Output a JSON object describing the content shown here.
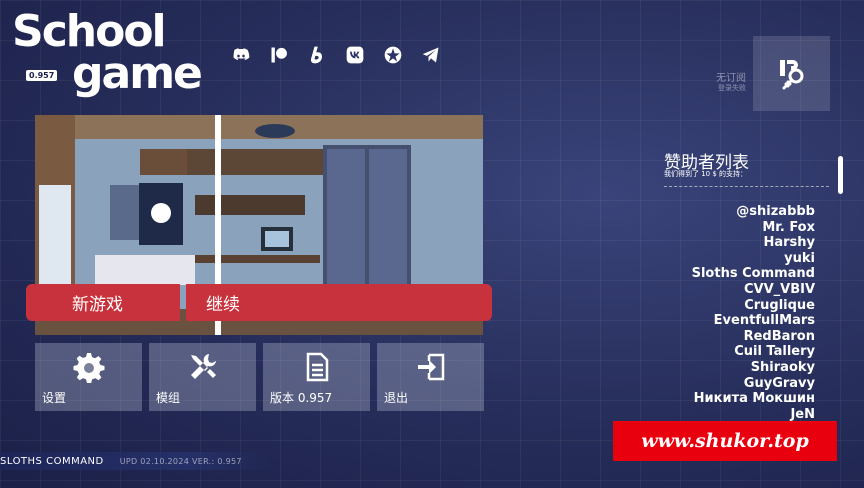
{
  "logo": {
    "line1": "School",
    "line2": "game",
    "version_badge": "0.957"
  },
  "socials": [
    {
      "icon": "discord-icon"
    },
    {
      "icon": "patreon-icon"
    },
    {
      "icon": "boosty-icon"
    },
    {
      "icon": "vk-icon"
    },
    {
      "icon": "subscribestar-icon"
    },
    {
      "icon": "telegram-icon"
    }
  ],
  "subscription": {
    "status": "无订阅",
    "note": "登录失败"
  },
  "menu": {
    "new_game": "新游戏",
    "continue": "继续",
    "settings": "设置",
    "mods": "模组",
    "version": "版本 0.957",
    "quit": "退出"
  },
  "sponsors": {
    "title": "赞助者列表",
    "subtitle": "我们得到了 10 $ 的支持：",
    "names": [
      "@shizabbb",
      "Mr. Fox",
      "Harshy",
      "yuki",
      "Sloths Command",
      "CVV_VBIV",
      "Cruglique",
      "EventfullMars",
      "RedBaron",
      "Cuil Tallery",
      "Shiraoky",
      "GuyGravy",
      "Никита Мокшин",
      "JeN"
    ]
  },
  "watermark": "www.shukor.top",
  "footer": {
    "developer": "SLOTHS COMMAND",
    "update": "UPD 02.10.2024 VER.: 0.957"
  },
  "colors": {
    "accent_red": "#c8323c",
    "background": "#232a55",
    "watermark_red": "#e8000f"
  }
}
